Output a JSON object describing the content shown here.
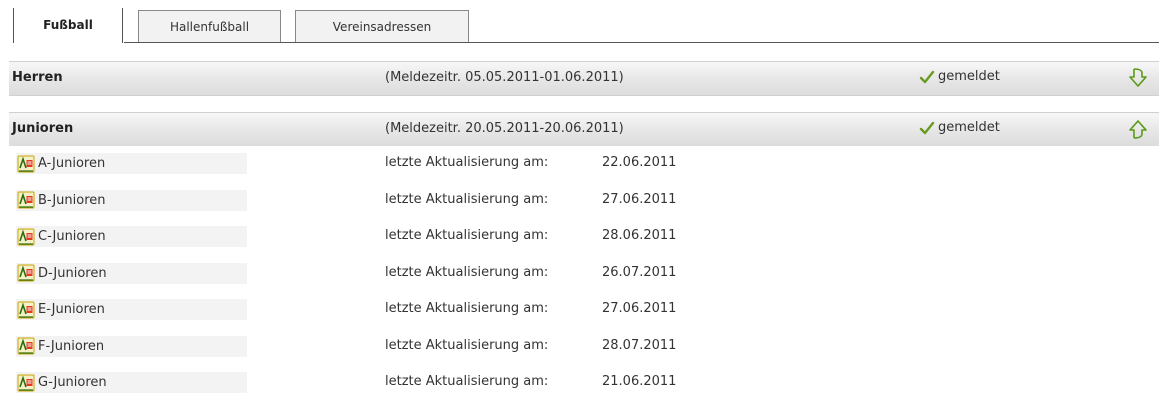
{
  "tabs": [
    {
      "label": "Fußball",
      "active": true
    },
    {
      "label": "Hallenfußball",
      "active": false
    },
    {
      "label": "Vereinsadressen",
      "active": false
    }
  ],
  "sections": {
    "herren": {
      "title": "Herren",
      "period": "(Meldezeitr. 05.05.2011-01.06.2011)",
      "status": "gemeldet",
      "status_icon": "checkmark-icon",
      "toggle_icon": "arrow-down-icon"
    },
    "junioren": {
      "title": "Junioren",
      "period": "(Meldezeitr. 20.05.2011-20.06.2011)",
      "status": "gemeldet",
      "status_icon": "checkmark-icon",
      "toggle_icon": "arrow-up-icon"
    }
  },
  "rows_label": "letzte Aktualisierung am:",
  "rows": [
    {
      "name": "A-Junioren",
      "label": "letzte Aktualisierung am:",
      "date": "22.06.2011"
    },
    {
      "name": "B-Junioren",
      "label": "letzte Aktualisierung am:",
      "date": "27.06.2011"
    },
    {
      "name": "C-Junioren",
      "label": "letzte Aktualisierung am:",
      "date": "28.06.2011"
    },
    {
      "name": "D-Junioren",
      "label": "letzte Aktualisierung am:",
      "date": "26.07.2011"
    },
    {
      "name": "E-Junioren",
      "label": "letzte Aktualisierung am:",
      "date": "27.06.2011"
    },
    {
      "name": "F-Junioren",
      "label": "letzte Aktualisierung am:",
      "date": "28.07.2011"
    },
    {
      "name": "G-Junioren",
      "label": "letzte Aktualisierung am:",
      "date": "21.06.2011"
    }
  ],
  "colors": {
    "accent_green": "#6a9a1f",
    "tab_border": "#555555",
    "header_bg": "#e6e6e6",
    "namebox_bg": "#f3f3f3"
  }
}
